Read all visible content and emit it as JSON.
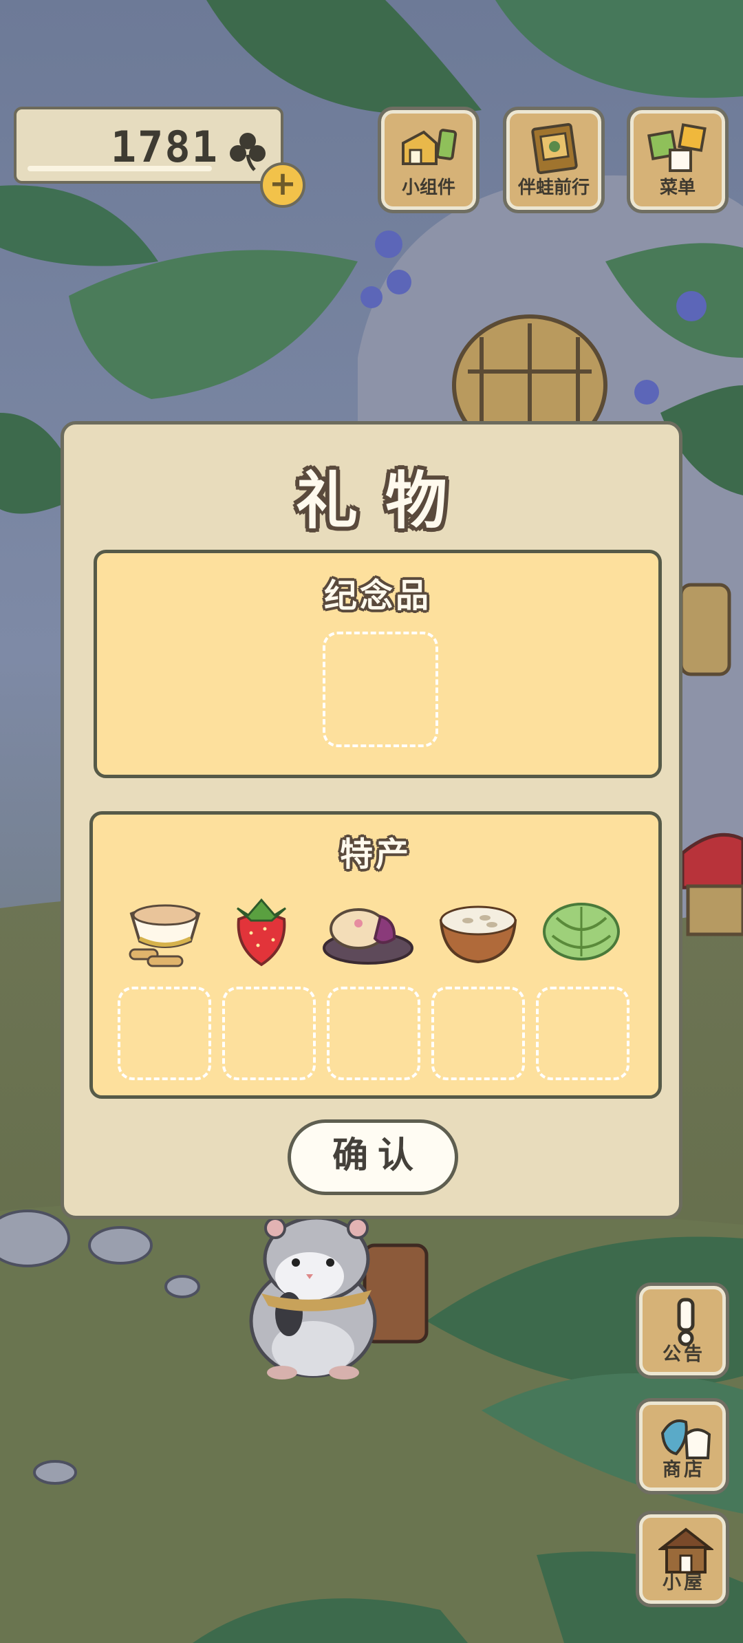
{
  "currency": {
    "clover_count": "1781",
    "clover_icon": "clover-icon",
    "add_icon": "plus-icon"
  },
  "top_menu": [
    {
      "label": "小组件",
      "icon": "widget-icon"
    },
    {
      "label": "伴蛙前行",
      "icon": "travel-album-icon"
    },
    {
      "label": "菜单",
      "icon": "menu-icon"
    }
  ],
  "dialog": {
    "title": "礼物",
    "souvenir_section": {
      "title": "纪念品"
    },
    "specialty_section": {
      "title": "特产",
      "items": [
        {
          "icon": "tea-cup-icon"
        },
        {
          "icon": "strawberry-icon"
        },
        {
          "icon": "pastry-icon"
        },
        {
          "icon": "rice-bowl-icon"
        },
        {
          "icon": "cabbage-icon"
        }
      ]
    },
    "confirm_label": "确认"
  },
  "side_menu": [
    {
      "label": "公告",
      "icon": "notice-icon"
    },
    {
      "label": "商店",
      "icon": "shop-icon"
    },
    {
      "label": "小屋",
      "icon": "house-icon"
    }
  ],
  "colors": {
    "panel": "#fde09d",
    "dialog_bg": "#e8dcbc",
    "button_wood": "#d6b277",
    "outline": "#5a4a3c"
  }
}
